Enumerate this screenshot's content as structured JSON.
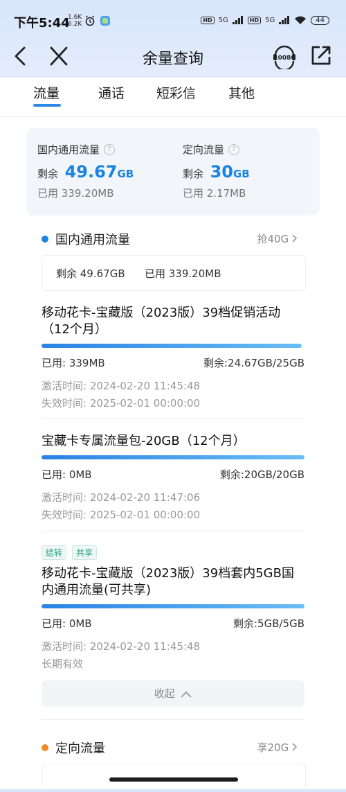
{
  "status": {
    "time": "下午5:44",
    "speed_up": "1.6K",
    "speed_down": "6.2K",
    "hd1": "HD",
    "hd2": "HD",
    "net1": "5G",
    "net2": "5G",
    "battery": "44"
  },
  "nav": {
    "title": "余量查询",
    "service_label": "10086"
  },
  "tabs": [
    {
      "label": "流量"
    },
    {
      "label": "通话"
    },
    {
      "label": "短彩信"
    },
    {
      "label": "其他"
    }
  ],
  "summary": {
    "domestic": {
      "label": "国内通用流量",
      "remain_prefix": "剩余",
      "remain_value": "49.67",
      "remain_unit": "GB",
      "used": "已用  339.20MB"
    },
    "targeted": {
      "label": "定向流量",
      "remain_prefix": "剩余",
      "remain_value": "30",
      "remain_unit": "GB",
      "used": "已用  2.17MB"
    }
  },
  "section_domestic": {
    "name": "国内通用流量",
    "more": "抢40G",
    "remain": "剩余 49.67GB",
    "used": "已用 339.20MB"
  },
  "packages": [
    {
      "name": "移动花卡-宝藏版（2023版）39档促销活动（12个月）",
      "used": "已用: 339MB",
      "remain": "剩余:24.67GB/25GB",
      "progress": 0.99,
      "activate": "激活时间: 2024-02-20 11:45:48",
      "expire": "失效时间: 2025-02-01 00:00:00"
    },
    {
      "name": "宝藏卡专属流量包-20GB（12个月）",
      "used": "已用: 0MB",
      "remain": "剩余:20GB/20GB",
      "progress": 1.0,
      "activate": "激活时间: 2024-02-20 11:47:06",
      "expire": "失效时间: 2025-02-01 00:00:00"
    },
    {
      "tags": [
        "结转",
        "共享"
      ],
      "name": "移动花卡-宝藏版（2023版）39档套内5GB国内通用流量(可共享)",
      "used": "已用: 0MB",
      "remain": "剩余:5GB/5GB",
      "progress": 1.0,
      "activate": "激活时间: 2024-02-20 11:45:48",
      "expire": "长期有效"
    }
  ],
  "collapse_label": "收起",
  "section_targeted": {
    "name": "定向流量",
    "more": "享20G"
  },
  "colors": {
    "accent": "#1a84e0",
    "dot_blue": "#1a84e0",
    "dot_orange": "#f0892a"
  }
}
